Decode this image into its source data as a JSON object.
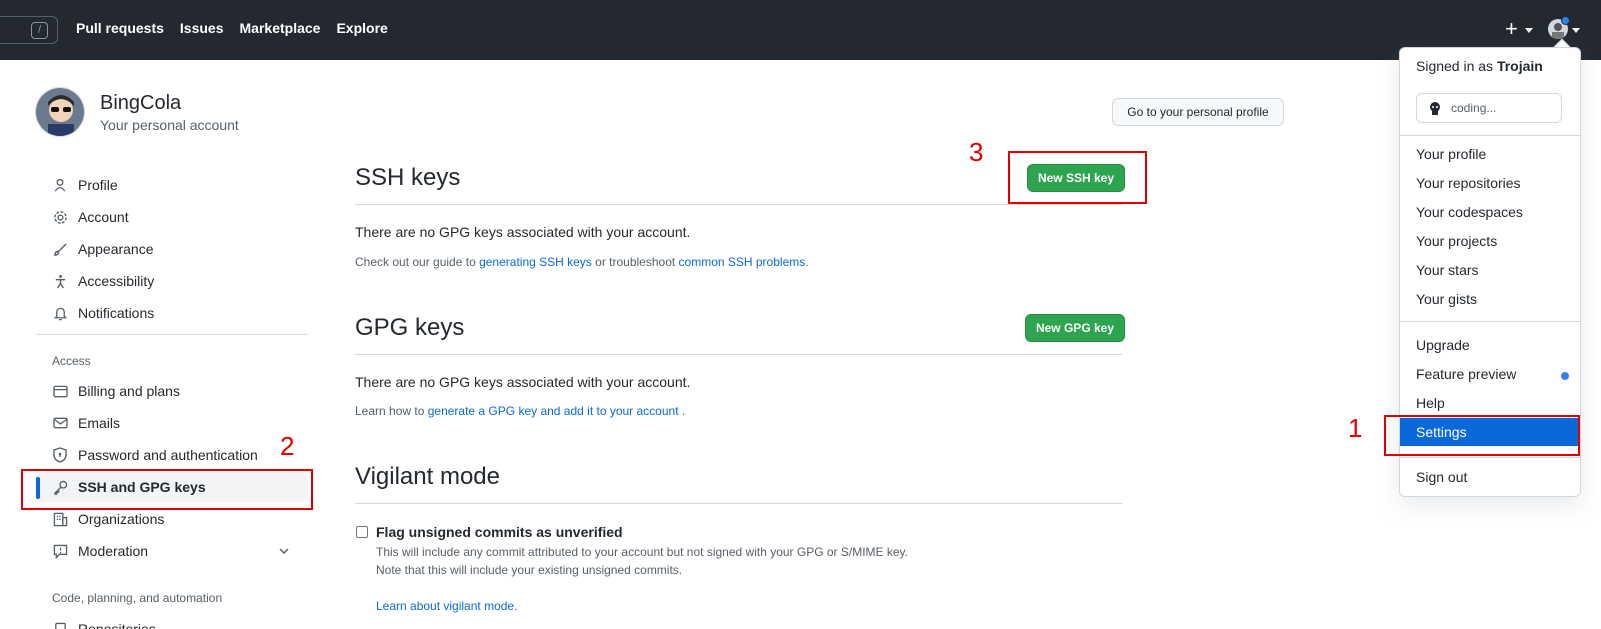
{
  "header": {
    "slash_key": "/",
    "nav": [
      "Pull requests",
      "Issues",
      "Marketplace",
      "Explore"
    ],
    "plus_label": "+"
  },
  "account": {
    "name": "BingCola",
    "subtitle": "Your personal account",
    "profile_button": "Go to your personal profile"
  },
  "sidebar": {
    "items": [
      {
        "label": "Profile",
        "icon": "person-icon"
      },
      {
        "label": "Account",
        "icon": "gear-icon"
      },
      {
        "label": "Appearance",
        "icon": "paintbrush-icon"
      },
      {
        "label": "Accessibility",
        "icon": "accessibility-icon"
      },
      {
        "label": "Notifications",
        "icon": "bell-icon"
      }
    ],
    "access_heading": "Access",
    "access_items": [
      {
        "label": "Billing and plans",
        "icon": "credit-card-icon"
      },
      {
        "label": "Emails",
        "icon": "mail-icon"
      },
      {
        "label": "Password and authentication",
        "icon": "shield-lock-icon"
      },
      {
        "label": "SSH and GPG keys",
        "icon": "key-icon",
        "active": true
      },
      {
        "label": "Organizations",
        "icon": "organization-icon"
      },
      {
        "label": "Moderation",
        "icon": "report-icon"
      }
    ],
    "code_heading": "Code, planning, and automation",
    "code_items": [
      {
        "label": "Repositories",
        "icon": "repo-icon"
      }
    ]
  },
  "ssh": {
    "title": "SSH keys",
    "button": "New SSH key",
    "empty": "There are no GPG keys associated with your account.",
    "help_pre": "Check out our guide to ",
    "help_link1": "generating SSH keys",
    "help_mid": " or troubleshoot ",
    "help_link2": "common SSH problems",
    "help_post": "."
  },
  "gpg": {
    "title": "GPG keys",
    "button": "New GPG key",
    "empty": "There are no GPG keys associated with your account.",
    "help_pre": "Learn how to ",
    "help_link": "generate a GPG key and add it to your account",
    "help_post": " ."
  },
  "vigilant": {
    "title": "Vigilant mode",
    "checkbox_label": "Flag unsigned commits as unverified",
    "desc1": "This will include any commit attributed to your account but not signed with your GPG or S/MIME key.",
    "desc2": "Note that this will include your existing unsigned commits.",
    "link": "Learn about vigilant mode",
    "link_post": "."
  },
  "dropdown": {
    "signed_in_pre": "Signed in as ",
    "username": "Trojain",
    "status": "coding...",
    "group1": [
      "Your profile",
      "Your repositories",
      "Your codespaces",
      "Your projects",
      "Your stars",
      "Your gists"
    ],
    "upgrade": "Upgrade",
    "feature_preview": "Feature preview",
    "help": "Help",
    "settings": "Settings",
    "sign_out": "Sign out"
  },
  "annotations": [
    "1",
    "2",
    "3"
  ],
  "colors": {
    "header_bg": "#24292f",
    "primary_button": "#2da44e",
    "link": "#0969da",
    "annotation": "#e00000"
  }
}
